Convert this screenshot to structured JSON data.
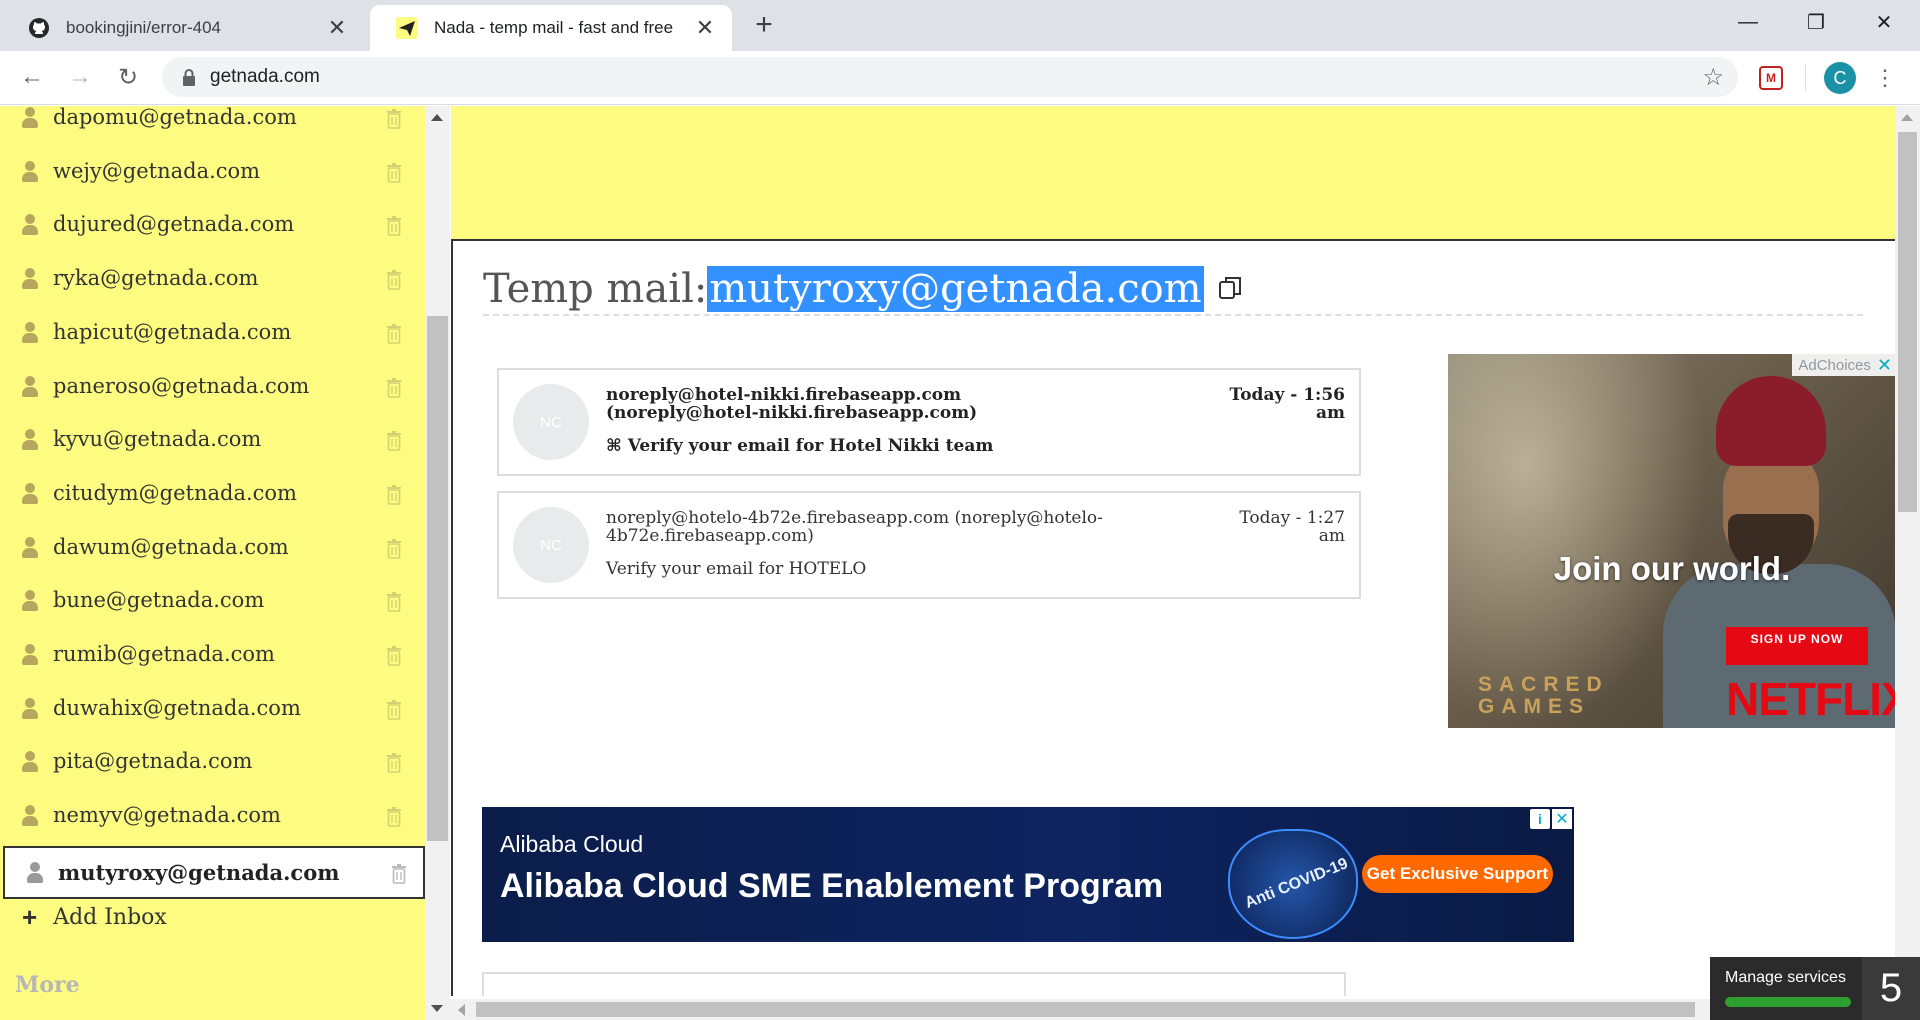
{
  "browser": {
    "tabs": [
      {
        "title": "bookingjini/error-404",
        "favicon": "github-icon",
        "active": false
      },
      {
        "title": "Nada - temp mail - fast and free",
        "favicon": "paper-plane-icon",
        "active": true
      }
    ],
    "url": "getnada.com",
    "profile_initial": "C"
  },
  "sidebar": {
    "inboxes": [
      {
        "address": "dapomu@getnada.com"
      },
      {
        "address": "wejy@getnada.com"
      },
      {
        "address": "dujured@getnada.com"
      },
      {
        "address": "ryka@getnada.com"
      },
      {
        "address": "hapicut@getnada.com"
      },
      {
        "address": "paneroso@getnada.com"
      },
      {
        "address": "kyvu@getnada.com"
      },
      {
        "address": "citudym@getnada.com"
      },
      {
        "address": "dawum@getnada.com"
      },
      {
        "address": "bune@getnada.com"
      },
      {
        "address": "rumib@getnada.com"
      },
      {
        "address": "duwahix@getnada.com"
      },
      {
        "address": "pita@getnada.com"
      },
      {
        "address": "nemyv@getnada.com"
      },
      {
        "address": "mutyroxy@getnada.com"
      }
    ],
    "active_address": "mutyroxy@getnada.com",
    "add_inbox_label": "Add Inbox",
    "more_label": "More"
  },
  "main": {
    "heading_prefix": "Temp mail:",
    "current_address": "mutyroxy@getnada.com",
    "messages": [
      {
        "avatar": "NC",
        "from": "noreply@hotel-nikki.firebaseapp.com (noreply@hotel-nikki.firebaseapp.com)",
        "time": "Today - 1:56 am",
        "subject": "⌘ Verify your email for Hotel Nikki team",
        "unread": true
      },
      {
        "avatar": "NC",
        "from": "noreply@hotelo-4b72e.firebaseapp.com (noreply@hotelo-4b72e.firebaseapp.com)",
        "time": "Today - 1:27 am",
        "subject": "Verify your email for HOTELO",
        "unread": false
      }
    ]
  },
  "ads": {
    "netflix": {
      "adchoices": "AdChoices",
      "headline": "Join our world.",
      "cta": "SIGN UP NOW",
      "brand": "NETFLIX",
      "show": "SACRED GAMES"
    },
    "alibaba": {
      "brand": "Alibaba Cloud",
      "headline": "Alibaba Cloud SME Enablement Program",
      "badge": "Anti COVID-19",
      "cta": "Get Exclusive Support"
    }
  },
  "manage_services": {
    "label": "Manage services",
    "count": "5"
  },
  "colors": {
    "sidebar_bg": "#fdfc80",
    "selection": "#3390ff",
    "netflix_red": "#e50914",
    "alibaba_orange": "#ff6a00"
  }
}
